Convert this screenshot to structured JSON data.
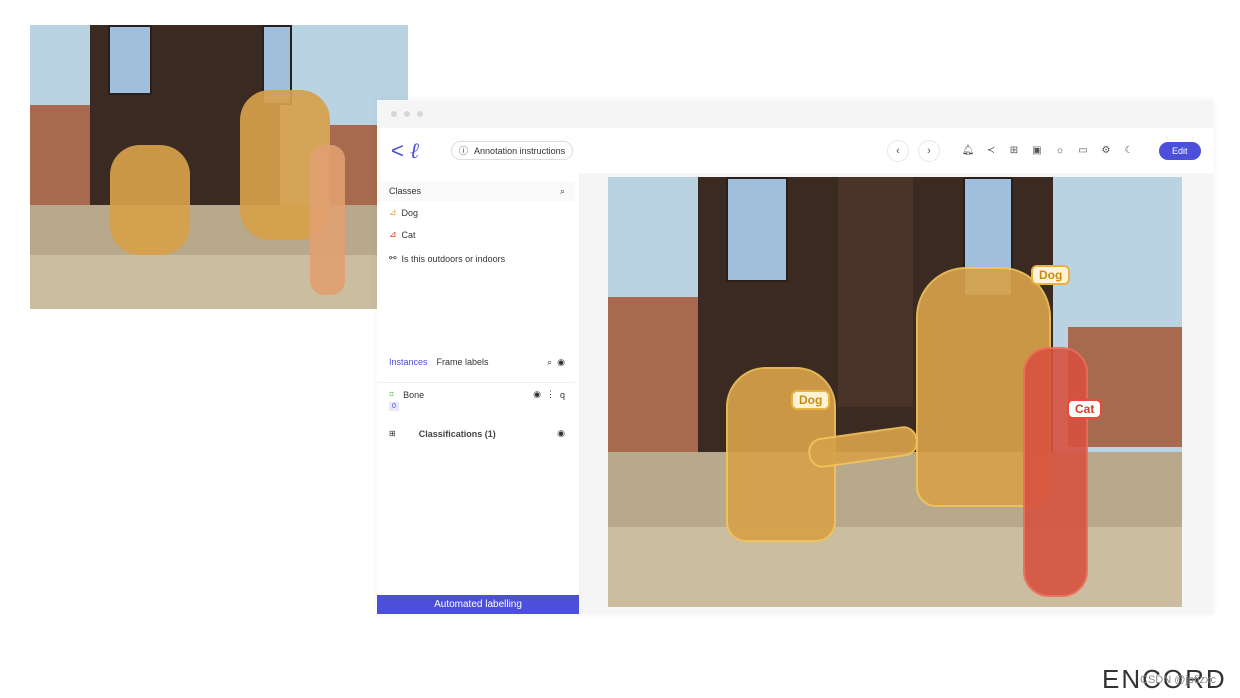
{
  "toolbar": {
    "instructions": "Annotation instructions",
    "edit": "Edit",
    "icons": [
      "bell-icon",
      "share-icon",
      "grid-add-icon",
      "save-icon",
      "sun-icon",
      "keyboard-icon",
      "settings-icon",
      "moon-icon"
    ]
  },
  "classes": {
    "title": "Classes",
    "items": [
      {
        "label": "Dog",
        "color": "#e0a53a"
      },
      {
        "label": "Cat",
        "color": "#d9382a"
      },
      {
        "label": "Is this outdoors or indoors"
      }
    ]
  },
  "instances": {
    "tab_active": "Instances",
    "tab_other": "Frame labels",
    "item": "Bone",
    "item_key": "q",
    "badge": "0",
    "classifications": "Classifications (1)"
  },
  "automated": "Automated labelling",
  "labels": {
    "dog1": "Dog",
    "dog2": "Dog",
    "cat": "Cat"
  },
  "brand": "ENCORD",
  "watermark": "CSDN @jpfizxc",
  "accent": "#4b4fd9"
}
